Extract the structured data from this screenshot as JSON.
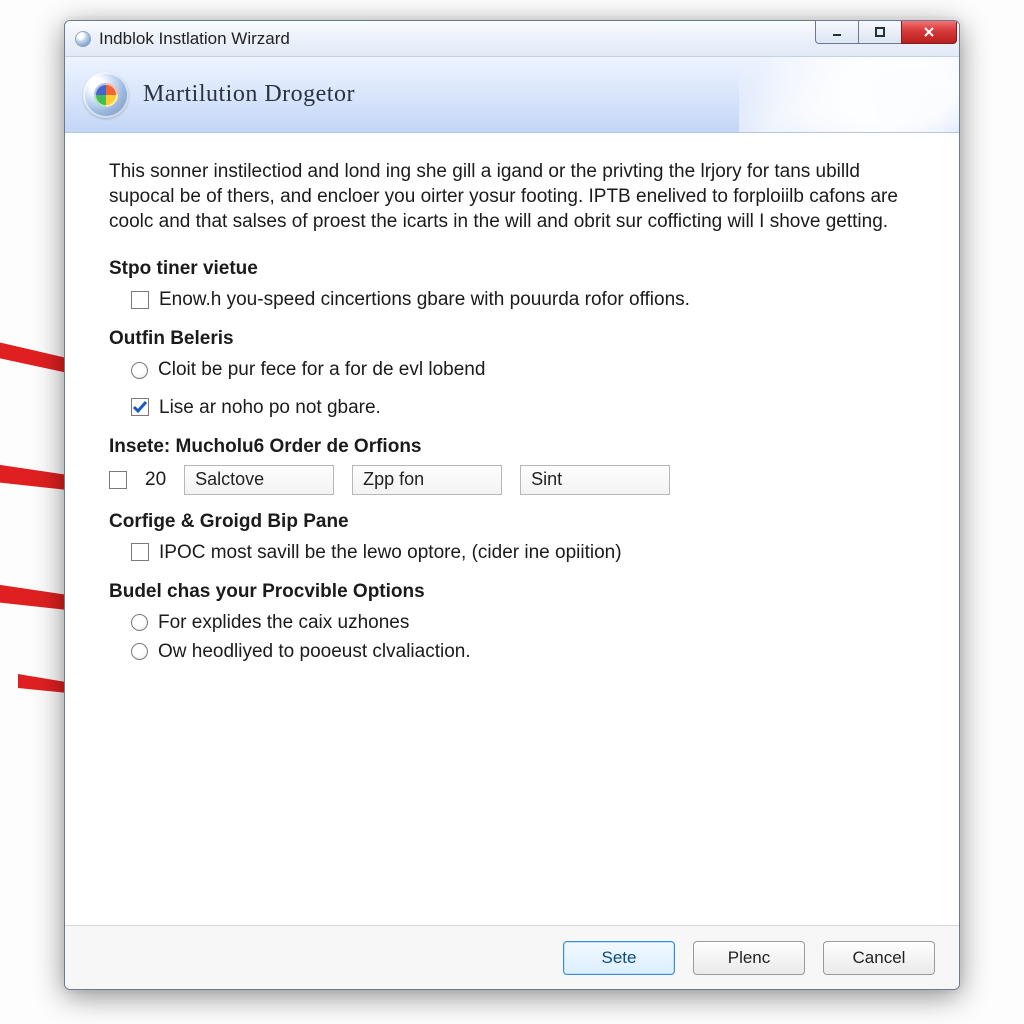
{
  "window": {
    "title": "Indblok Instlation Wirzard"
  },
  "banner": {
    "heading": "Martilution Drogetor"
  },
  "intro": "This sonner instilectiod and lond ing she gill a igand or the privting the lrjory for tans ubilld supocal be of thers, and encloer you oirter yosur footing. IPTB enelived to forploiilb cafons are coolc and that salses of proest the icarts in the will and obrit sur cofficting will I shove getting.",
  "sections": {
    "stpo": {
      "title": "Stpo tiner vietue",
      "chk1_label": "Enow.h you-speed cincertions gbare with pouurda rofor offions."
    },
    "outfin": {
      "title": "Outfin Beleris",
      "radio_label": "Cloit be pur fece for a for de evl lobend",
      "chk_label": "Lise ar noho po not gbare."
    },
    "insete": {
      "title": "Insete: Mucholu6 Order de Orfions",
      "num": "20",
      "field1": "Salctove",
      "field2": "Zpp fon",
      "field3": "Sint"
    },
    "corfige": {
      "title": "Corfige & Groigd Bip Pane",
      "chk_label": "IPOC most savill be the lewo optore, (cider ine opiition)"
    },
    "budel": {
      "title": "Budel chas your Procvible Options",
      "radio1": "For explides the caix uzhones",
      "radio2": "Ow heodliyed to pooeust clvaliaction."
    }
  },
  "footer": {
    "primary": "Sete",
    "secondary": "Plenc",
    "cancel": "Cancel"
  }
}
